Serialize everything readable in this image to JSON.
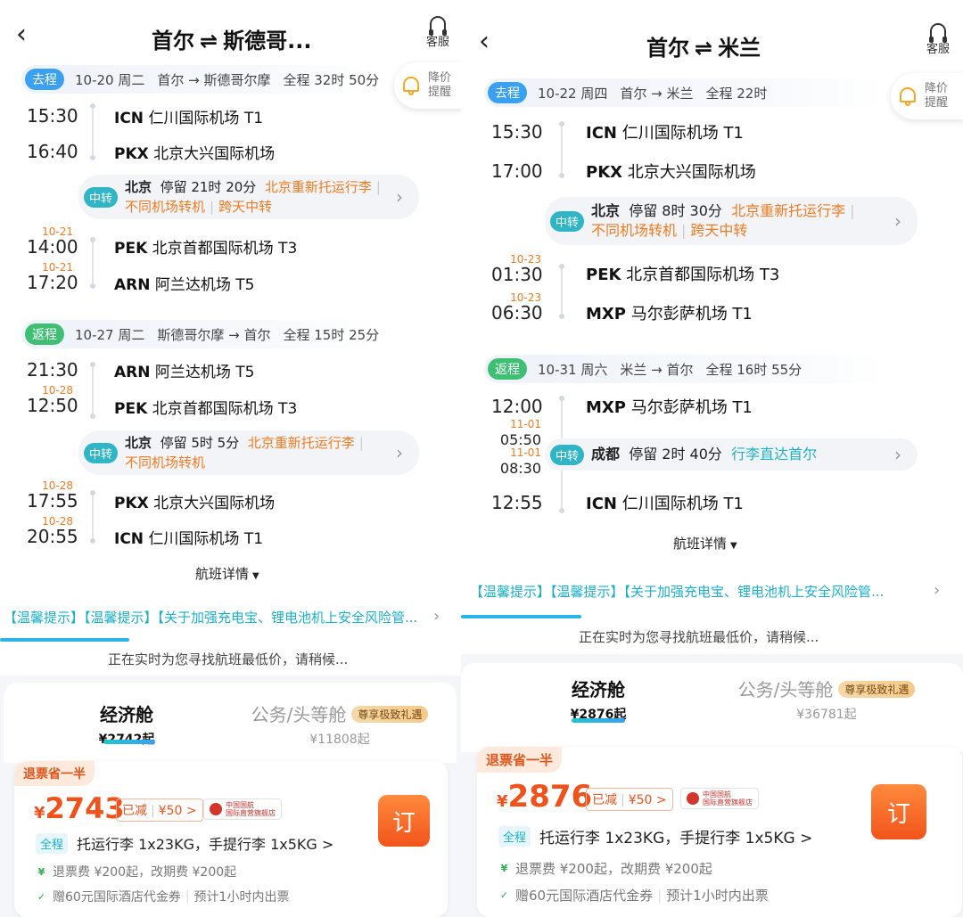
{
  "left": {
    "title_from": "首尔",
    "title_arrow": "⇌",
    "title_to": "斯德哥...",
    "cs_label": "客服",
    "alert_label": "降价提醒",
    "outbound": {
      "tag": "去程",
      "date": "10-20 周二",
      "route": "首尔 → 斯德哥尔摩",
      "total": "全程 32时 50分",
      "flights": [
        {
          "time": "15:30",
          "date": "",
          "code": "ICN",
          "airport": "仁川国际机场 T1"
        },
        {
          "time": "16:40",
          "date": "",
          "code": "PKX",
          "airport": "北京大兴国际机场"
        },
        {
          "time": "14:00",
          "date": "10-21",
          "code": "PEK",
          "airport": "北京首都国际机场 T3"
        },
        {
          "time": "17:20",
          "date": "10-21",
          "code": "ARN",
          "airport": "阿兰达机场 T5"
        }
      ],
      "transfer": {
        "tag": "中转",
        "city": "北京",
        "stay": "停留 21时 20分",
        "note1": "北京重新托运行李",
        "note2": "不同机场转机",
        "note3": "跨天中转"
      }
    },
    "inbound": {
      "tag": "返程",
      "date": "10-27 周二",
      "route": "斯德哥尔摩 → 首尔",
      "total": "全程 15时 25分",
      "flights": [
        {
          "time": "21:30",
          "date": "",
          "code": "ARN",
          "airport": "阿兰达机场 T5"
        },
        {
          "time": "12:50",
          "date": "10-28",
          "code": "PEK",
          "airport": "北京首都国际机场 T3"
        },
        {
          "time": "17:55",
          "date": "10-28",
          "code": "PKX",
          "airport": "北京大兴国际机场"
        },
        {
          "time": "20:55",
          "date": "10-28",
          "code": "ICN",
          "airport": "仁川国际机场 T1"
        }
      ],
      "transfer": {
        "tag": "中转",
        "city": "北京",
        "stay": "停留 5时 5分",
        "note1": "北京重新托运行李",
        "note2": "不同机场转机"
      }
    },
    "detail_label": "航班详情",
    "notice": "【温馨提示】【温馨提示】【关于加强充电宝、锂电池机上安全风险管...",
    "searching": "正在实时为您寻找航班最低价，请稍候...",
    "progress": 0.28,
    "cabins": [
      {
        "name": "经济舱",
        "price": "¥2742起"
      },
      {
        "name": "公务/头等舱",
        "price": "¥11808起",
        "badge": "尊享极致礼遇"
      }
    ],
    "offer": {
      "refund_tag": "退票省一半",
      "yen": "¥",
      "price": "2743",
      "discount_label": "已减",
      "discount_value": "¥50 >",
      "airline": "中国国航",
      "airline_sub": "国际直营旗舰店",
      "book": "订",
      "bag_tag": "全程",
      "bag": "托运行李 1x23KG，手提行李 1x5KG >",
      "fee": "退票费 ¥200起，改期费 ¥200起",
      "coupon": "赠60元国际酒店代金券",
      "ticketing": "预计1小时内出票"
    }
  },
  "right": {
    "title_from": "首尔",
    "title_arrow": "⇌",
    "title_to": "米兰",
    "cs_label": "客服",
    "alert_label": "降价提醒",
    "outbound": {
      "tag": "去程",
      "date": "10-22 周四",
      "route": "首尔 → 米兰",
      "total": "全程 22时",
      "flights": [
        {
          "time": "15:30",
          "date": "",
          "code": "ICN",
          "airport": "仁川国际机场 T1"
        },
        {
          "time": "17:00",
          "date": "",
          "code": "PKX",
          "airport": "北京大兴国际机场"
        },
        {
          "time": "01:30",
          "date": "10-23",
          "code": "PEK",
          "airport": "北京首都国际机场 T3"
        },
        {
          "time": "06:30",
          "date": "10-23",
          "code": "MXP",
          "airport": "马尔彭萨机场 T1"
        }
      ],
      "transfer": {
        "tag": "中转",
        "city": "北京",
        "stay": "停留 8时 30分",
        "note1": "北京重新托运行李",
        "note2": "不同机场转机",
        "note3": "跨天中转"
      }
    },
    "inbound": {
      "tag": "返程",
      "date": "10-31 周六",
      "route": "米兰 → 首尔",
      "total": "全程 16时 55分",
      "flights": [
        {
          "time": "12:00",
          "date": "",
          "code": "MXP",
          "airport": "马尔彭萨机场 T1"
        },
        {
          "time": "05:50",
          "date": "11-01",
          "code": "",
          "airport": ""
        },
        {
          "time": "08:30",
          "date": "11-01",
          "code": "",
          "airport": ""
        },
        {
          "time": "12:55",
          "date": "",
          "code": "ICN",
          "airport": "仁川国际机场 T1"
        }
      ],
      "transfer": {
        "tag": "中转",
        "city": "成都",
        "stay": "停留 2时 40分",
        "note1": "行李直达首尔"
      }
    },
    "detail_label": "航班详情",
    "notice": "【温馨提示】【温馨提示】【关于加强充电宝、锂电池机上安全风险管...",
    "searching": "正在实时为您寻找航班最低价，请稍候...",
    "progress": 0.24,
    "cabins": [
      {
        "name": "经济舱",
        "price": "¥2876起"
      },
      {
        "name": "公务/头等舱",
        "price": "¥36781起",
        "badge": "尊享极致礼遇"
      }
    ],
    "offer": {
      "refund_tag": "退票省一半",
      "yen": "¥",
      "price": "2876",
      "discount_label": "已减",
      "discount_value": "¥50 >",
      "airline": "中国国航",
      "airline_sub": "国际直营旗舰店",
      "book": "订",
      "bag_tag": "全程",
      "bag": "托运行李 1x23KG，手提行李 1x5KG >",
      "fee": "退票费 ¥200起，改期费 ¥200起",
      "coupon": "赠60元国际酒店代金券",
      "ticketing": "预计1小时内出票"
    }
  }
}
